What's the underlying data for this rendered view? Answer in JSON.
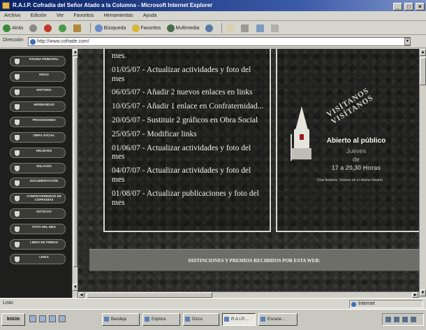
{
  "window": {
    "title": "R.A.I.P. Cofradía del Señor Atado a la Columna - Microsoft Internet Explorer",
    "controls": [
      "_",
      "□",
      "×"
    ]
  },
  "menu": [
    "Archivo",
    "Edición",
    "Ver",
    "Favoritos",
    "Herramientas",
    "Ayuda"
  ],
  "toolbar": {
    "back": "Atrás",
    "search": "Búsqueda",
    "favorites": "Favoritos",
    "multimedia": "Multimedia"
  },
  "address": {
    "label": "Dirección",
    "url": "http://www.cofrade.com/",
    "dropdown": "▾"
  },
  "sidebar": {
    "items": [
      "Página principal",
      "Inicio",
      "Historia",
      "Hermandad",
      "Procesiones",
      "Obra social",
      "Relieves",
      "Enlaces",
      "Documentación",
      "Confraternidad de cofradías",
      "Noticias",
      "Foto del mes",
      "Libro de firmas",
      "Links"
    ]
  },
  "news": {
    "fragment": "mes.",
    "entries": [
      "01/05/07 - Actualizar actividades y foto del mes",
      "06/05/07 - Añadir 2 nuevos enlaces en links",
      "10/05/07 - Añadir 1 enlace en Confraternidad...",
      "20/05/07 - Sustituir 2 gráficos en Obra Social",
      "25/05/07 - Modificar links",
      "01/06/07 - Actualizar actividades y foto del mes",
      "04/07/07 - Actualizar actividades y foto del mes",
      "01/08/07 - Actualizar publicaciones y foto del mes"
    ]
  },
  "visit": {
    "ribbon_top": "VISÍTANOS",
    "ribbon_bottom": "VISÍTANOS",
    "open_text": "Abierto al público",
    "days": "Jueves",
    "de": "de",
    "hours": "17 a 20,30 Horas",
    "holidays": "Días festivos, Viernes en el mismo horario"
  },
  "awards_banner": "DISTINCIONES Y PREMIOS RECIBIDOS POR ESTA WEB:",
  "status": {
    "text": "Listo",
    "zone": "Internet"
  },
  "taskbar": {
    "start": "Inicio",
    "tasks": [
      "Bandeja",
      "Explora",
      "Disco",
      "R.A.I.P....",
      "Escane..."
    ]
  },
  "colors": {
    "page_background": "#2a2a28",
    "awards_bar": "#6e6e68",
    "title_bar": "#0a2266"
  }
}
